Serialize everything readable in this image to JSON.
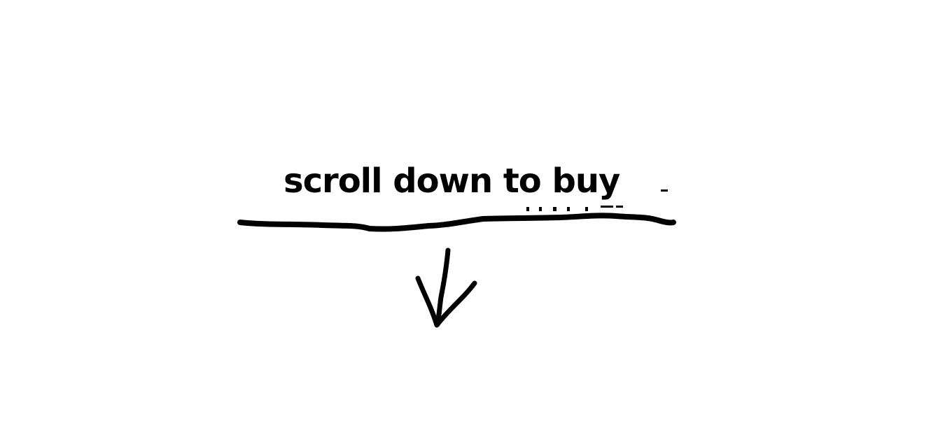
{
  "message": {
    "text": "scroll down to buy"
  },
  "decorations": {
    "underline": "hand-drawn-underline",
    "arrow": "arrow-down-icon",
    "ink_color": "#000000",
    "background_color": "#ffffff"
  }
}
